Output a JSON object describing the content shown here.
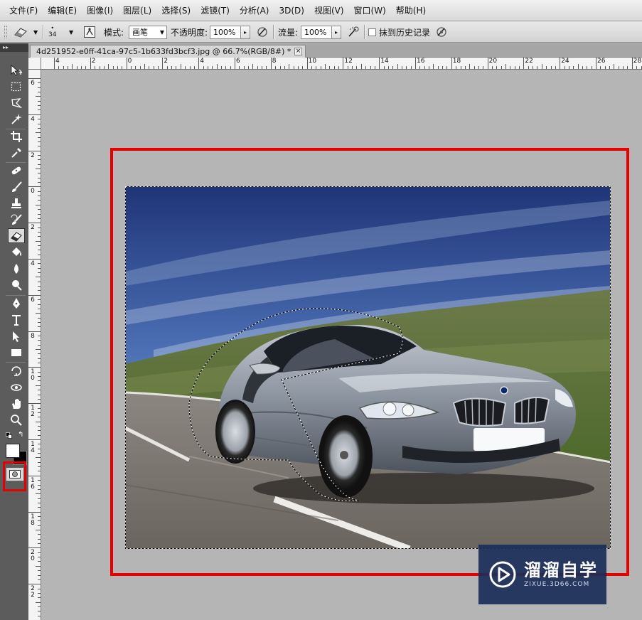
{
  "menu": [
    "文件(F)",
    "编辑(E)",
    "图像(I)",
    "图层(L)",
    "选择(S)",
    "滤镜(T)",
    "分析(A)",
    "3D(D)",
    "视图(V)",
    "窗口(W)",
    "帮助(H)"
  ],
  "options": {
    "brush_size": "34",
    "mode_label": "模式:",
    "mode_value": "画笔",
    "opacity_label": "不透明度:",
    "opacity_value": "100%",
    "flow_label": "流量:",
    "flow_value": "100%",
    "erase_history_label": "抹到历史记录"
  },
  "document": {
    "tab_title": "4d251952-e0ff-41ca-97c5-1b633fd3bcf3.jpg @ 66.7%(RGB/8#) *",
    "close_glyph": "×"
  },
  "rulers": {
    "horizontal_labels": [
      "4",
      "2",
      "0",
      "2",
      "4",
      "6",
      "8",
      "10",
      "12",
      "14",
      "16",
      "18",
      "20",
      "22",
      "24",
      "26",
      "28"
    ],
    "vertical_labels": [
      "6",
      "4",
      "2",
      "0",
      "2",
      "4",
      "6",
      "8",
      "10",
      "12",
      "14",
      "16",
      "18",
      "20",
      "22"
    ]
  },
  "toolbox": {
    "header": "▸▸",
    "tools": [
      "move-tool-icon",
      "marquee-tool-icon",
      "lasso-tool-icon",
      "quick-selection-tool-icon",
      "crop-tool-icon",
      "eyedropper-tool-icon",
      "healing-brush-tool-icon",
      "brush-tool-icon",
      "clone-stamp-tool-icon",
      "history-brush-tool-icon",
      "eraser-tool-icon",
      "paint-bucket-tool-icon",
      "blur-tool-icon",
      "dodge-tool-icon",
      "pen-tool-icon",
      "type-tool-icon",
      "path-selection-tool-icon",
      "rectangle-tool-icon",
      "3d-rotate-tool-icon",
      "3d-orbit-tool-icon",
      "hand-tool-icon",
      "zoom-tool-icon"
    ],
    "active_tool": "eraser-tool-icon",
    "swap_glyph": "↰"
  },
  "watermark": {
    "title": "溜溜自学",
    "url": "ZIXUE.3D66.COM"
  },
  "colors": {
    "highlight": "#e60000",
    "foreground": "#ffffff",
    "background": "#000000",
    "watermark_bg": "#1a2e58"
  }
}
